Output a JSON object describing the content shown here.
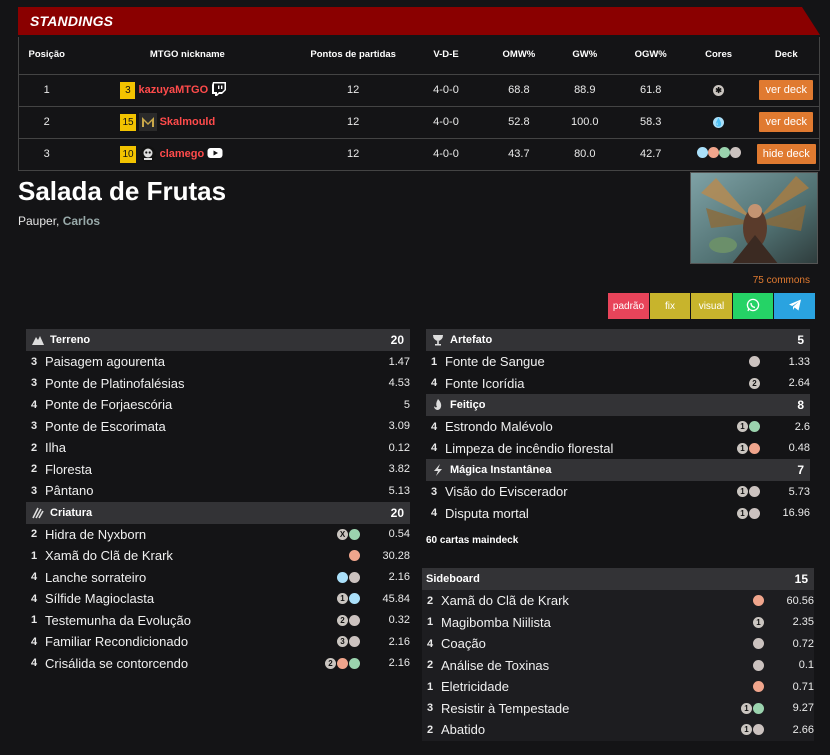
{
  "standings": {
    "title": "STANDINGS",
    "headers": [
      "Posição",
      "MTGO nickname",
      "Pontos de partidas",
      "V-D-E",
      "OMW%",
      "GW%",
      "OGW%",
      "Cores",
      "Deck"
    ],
    "rows": [
      {
        "pos": "1",
        "rank": "3",
        "name": "kazuyaMTGO",
        "platform": "twitch-icon",
        "points": "12",
        "vde": "4-0-0",
        "omw": "68.8",
        "gw": "88.9",
        "ogw": "61.8",
        "colors": [
          "c"
        ],
        "deck": "ver deck"
      },
      {
        "pos": "2",
        "rank": "15",
        "name": "Skalmould",
        "platform": "mtgo-logo-icon",
        "points": "12",
        "vde": "4-0-0",
        "omw": "52.8",
        "gw": "100.0",
        "ogw": "58.3",
        "colors": [
          "u"
        ],
        "deck": "ver deck"
      },
      {
        "pos": "3",
        "rank": "10",
        "name": "clamego",
        "platform": "youtube-icon",
        "points": "12",
        "vde": "4-0-0",
        "omw": "43.7",
        "gw": "80.0",
        "ogw": "42.7",
        "colors": [
          "u",
          "r",
          "g",
          "b"
        ],
        "deck": "hide deck"
      }
    ]
  },
  "deck": {
    "title": "Salada de Frutas",
    "format": "Pauper",
    "author": "Carlos",
    "commons_label": "75 commons",
    "buttons": [
      {
        "label": "padrão",
        "color": "#e8445a"
      },
      {
        "label": "fix",
        "color": "#c8b42c"
      },
      {
        "label": "visual",
        "color": "#c8b42c"
      },
      {
        "label": "",
        "icon": "whatsapp-icon",
        "color": "#25d366"
      },
      {
        "label": "",
        "icon": "telegram-icon",
        "color": "#2aa3e0"
      }
    ],
    "maindeck_label": "60 cartas maindeck"
  },
  "sections": {
    "terreno": {
      "title": "Terreno",
      "count": "20",
      "icon": "land-icon",
      "cards": [
        {
          "qty": "3",
          "name": "Paisagem agourenta",
          "cost": [],
          "price": "1.47"
        },
        {
          "qty": "3",
          "name": "Ponte de Platinofalésias",
          "cost": [],
          "price": "4.53"
        },
        {
          "qty": "4",
          "name": "Ponte de Forjaescória",
          "cost": [],
          "price": "5"
        },
        {
          "qty": "3",
          "name": "Ponte de Escorimata",
          "cost": [],
          "price": "3.09"
        },
        {
          "qty": "2",
          "name": "Ilha",
          "cost": [],
          "price": "0.12"
        },
        {
          "qty": "2",
          "name": "Floresta",
          "cost": [],
          "price": "3.82"
        },
        {
          "qty": "3",
          "name": "Pântano",
          "cost": [],
          "price": "5.13"
        }
      ]
    },
    "criatura": {
      "title": "Criatura",
      "count": "20",
      "icon": "creature-claw-icon",
      "cards": [
        {
          "qty": "2",
          "name": "Hidra de Nyxborn",
          "cost": [
            [
              "x",
              "X"
            ],
            [
              "g",
              ""
            ]
          ],
          "price": "0.54"
        },
        {
          "qty": "1",
          "name": "Xamã do Clã de Krark",
          "cost": [
            [
              "r",
              ""
            ]
          ],
          "price": "30.28"
        },
        {
          "qty": "4",
          "name": "Lanche sorrateiro",
          "cost": [
            [
              "u",
              ""
            ],
            [
              "b",
              ""
            ]
          ],
          "price": "2.16"
        },
        {
          "qty": "4",
          "name": "Sílfide Magioclasta",
          "cost": [
            [
              "c",
              "1"
            ],
            [
              "u",
              ""
            ]
          ],
          "price": "45.84"
        },
        {
          "qty": "1",
          "name": "Testemunha da Evolução",
          "cost": [
            [
              "c",
              "2"
            ],
            [
              "b",
              ""
            ]
          ],
          "price": "0.32"
        },
        {
          "qty": "4",
          "name": "Familiar Recondicionado",
          "cost": [
            [
              "c",
              "3"
            ],
            [
              "b",
              ""
            ]
          ],
          "price": "2.16"
        },
        {
          "qty": "4",
          "name": "Crisálida se contorcendo",
          "cost": [
            [
              "c",
              "2"
            ],
            [
              "r",
              ""
            ],
            [
              "g",
              ""
            ]
          ],
          "price": "2.16"
        }
      ]
    },
    "artefato": {
      "title": "Artefato",
      "count": "5",
      "icon": "artifact-chalice-icon",
      "cards": [
        {
          "qty": "1",
          "name": "Fonte de Sangue",
          "cost": [
            [
              "b",
              ""
            ]
          ],
          "price": "1.33"
        },
        {
          "qty": "4",
          "name": "Fonte Icorídia",
          "cost": [
            [
              "c",
              "2"
            ]
          ],
          "price": "2.64"
        }
      ]
    },
    "feitico": {
      "title": "Feitiço",
      "count": "8",
      "icon": "sorcery-flame-icon",
      "cards": [
        {
          "qty": "4",
          "name": "Estrondo Malévolo",
          "cost": [
            [
              "c",
              "1"
            ],
            [
              "g",
              ""
            ]
          ],
          "price": "2.6"
        },
        {
          "qty": "4",
          "name": "Limpeza de incêndio florestal",
          "cost": [
            [
              "c",
              "1"
            ],
            [
              "r",
              ""
            ]
          ],
          "price": "0.48"
        }
      ]
    },
    "instantanea": {
      "title": "Mágica Instantânea",
      "count": "7",
      "icon": "instant-bolt-icon",
      "cards": [
        {
          "qty": "3",
          "name": "Visão do Eviscerador",
          "cost": [
            [
              "c",
              "1"
            ],
            [
              "b",
              ""
            ]
          ],
          "price": "5.73"
        },
        {
          "qty": "4",
          "name": "Disputa mortal",
          "cost": [
            [
              "c",
              "1"
            ],
            [
              "b",
              ""
            ]
          ],
          "price": "16.96"
        }
      ]
    },
    "sideboard": {
      "title": "Sideboard",
      "count": "15",
      "cards": [
        {
          "qty": "2",
          "name": "Xamã do Clã de Krark",
          "cost": [
            [
              "r",
              ""
            ]
          ],
          "price": "60.56"
        },
        {
          "qty": "1",
          "name": "Magibomba Niilista",
          "cost": [
            [
              "c",
              "1"
            ]
          ],
          "price": "2.35"
        },
        {
          "qty": "4",
          "name": "Coação",
          "cost": [
            [
              "b",
              ""
            ]
          ],
          "price": "0.72"
        },
        {
          "qty": "2",
          "name": "Análise de Toxinas",
          "cost": [
            [
              "b",
              ""
            ]
          ],
          "price": "0.1"
        },
        {
          "qty": "1",
          "name": "Eletricidade",
          "cost": [
            [
              "r",
              ""
            ]
          ],
          "price": "0.71"
        },
        {
          "qty": "3",
          "name": "Resistir à Tempestade",
          "cost": [
            [
              "c",
              "1"
            ],
            [
              "g",
              ""
            ]
          ],
          "price": "9.27"
        },
        {
          "qty": "2",
          "name": "Abatido",
          "cost": [
            [
              "c",
              "1"
            ],
            [
              "b",
              ""
            ]
          ],
          "price": "2.66"
        }
      ]
    }
  }
}
